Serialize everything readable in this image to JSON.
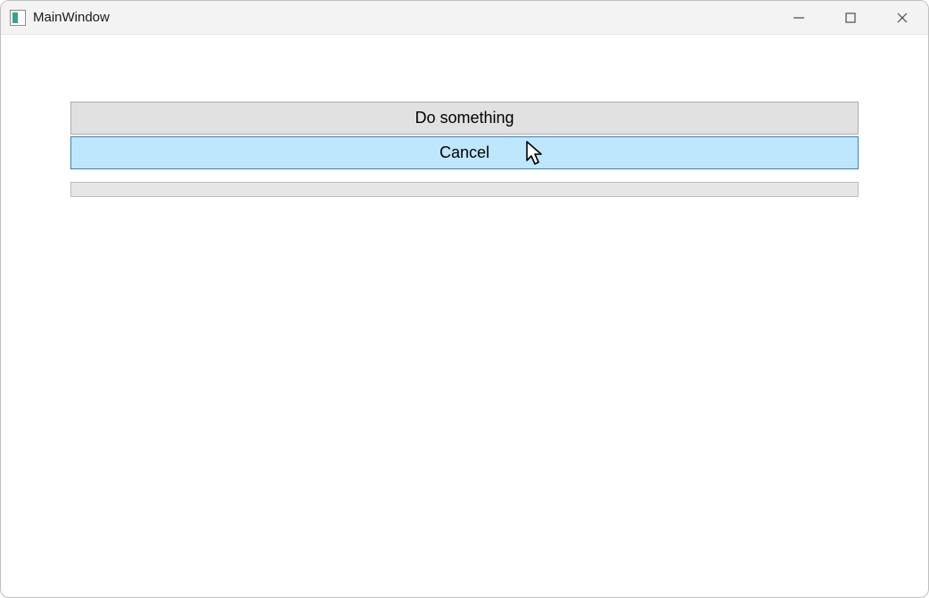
{
  "window": {
    "title": "MainWindow"
  },
  "buttons": {
    "do_something": "Do something",
    "cancel": "Cancel"
  }
}
